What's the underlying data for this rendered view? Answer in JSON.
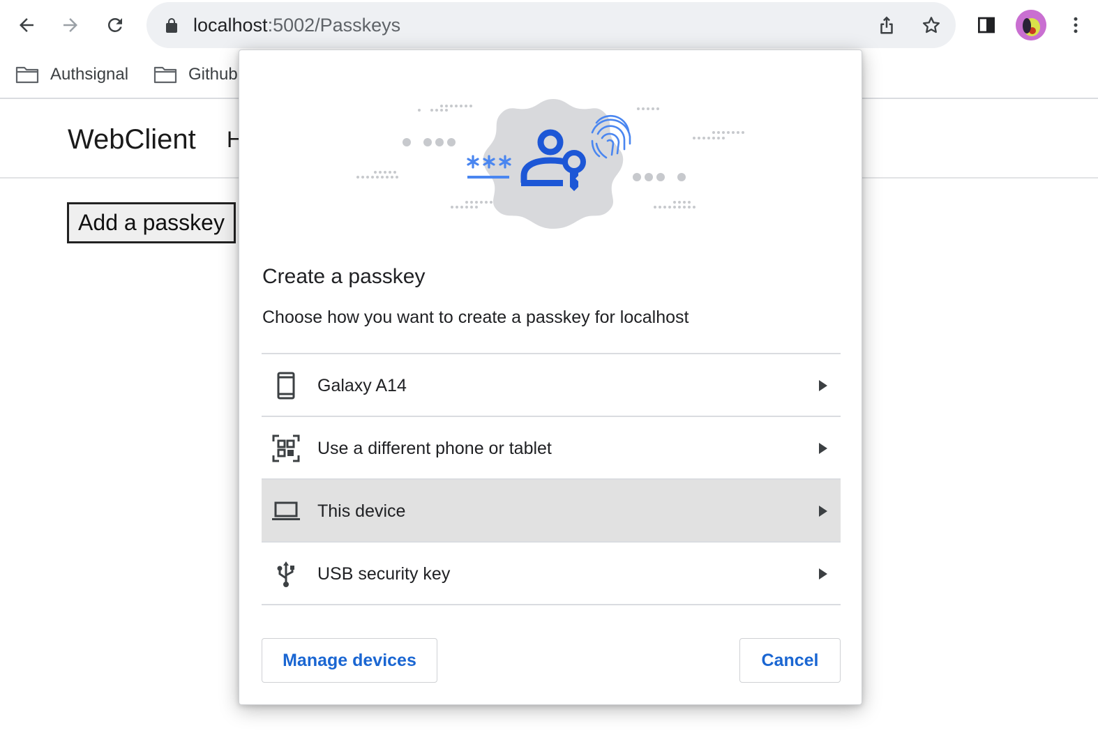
{
  "browser": {
    "url_host": "localhost",
    "url_path": ":5002/Passkeys",
    "bookmarks": [
      {
        "label": "Authsignal",
        "icon": "folder-icon"
      },
      {
        "label": "Github",
        "icon": "folder-icon"
      }
    ]
  },
  "page": {
    "brand": "WebClient",
    "nav_first_item": "H",
    "add_passkey_label": "Add a passkey"
  },
  "dialog": {
    "title": "Create a passkey",
    "subtitle": "Choose how you want to create a passkey for localhost",
    "options": [
      {
        "label": "Galaxy A14",
        "icon": "phone-icon",
        "selected": false
      },
      {
        "label": "Use a different phone or tablet",
        "icon": "qr-code-icon",
        "selected": false
      },
      {
        "label": "This device",
        "icon": "laptop-icon",
        "selected": true
      },
      {
        "label": "USB security key",
        "icon": "usb-icon",
        "selected": false
      }
    ],
    "manage_label": "Manage devices",
    "cancel_label": "Cancel",
    "accent_color": "#1a66d2",
    "selected_row_color": "#e1e1e1"
  }
}
